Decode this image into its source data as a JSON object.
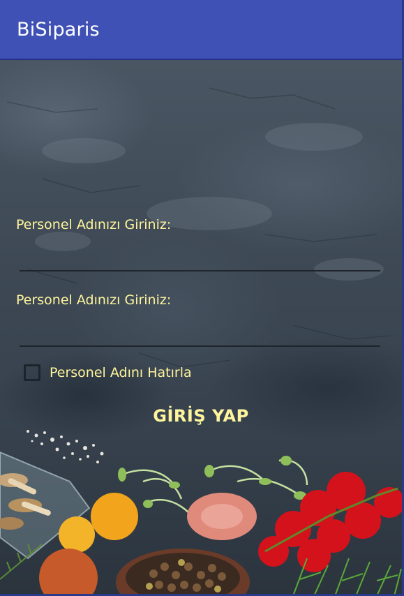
{
  "app_bar": {
    "title": "BiSiparis"
  },
  "form": {
    "username": {
      "label": "Personel Adınızı Giriniz:",
      "value": ""
    },
    "password": {
      "label": "Personel Adınızı Giriniz:",
      "value": ""
    },
    "remember": {
      "label": "Personel Adını Hatırla",
      "checked": false
    },
    "login_button": {
      "label": "GİRİŞ YAP"
    }
  },
  "colors": {
    "app_bar": "#3f51b5",
    "label_text": "#fff59d",
    "background": "#3d4854"
  },
  "icons": [
    "checkbox-icon"
  ]
}
